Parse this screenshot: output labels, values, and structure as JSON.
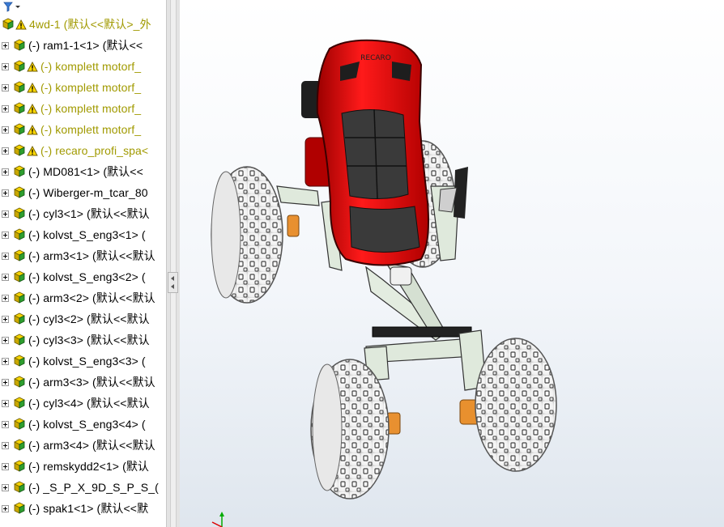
{
  "feature_tree": {
    "filter_icon": "funnel-icon",
    "root": {
      "label": "4wd-1 (默认<<默认>_外",
      "status": "warning"
    },
    "items": [
      {
        "label": "(-) ram1-1<1> (默认<<",
        "status": "normal"
      },
      {
        "label": "(-) komplett motorf_",
        "status": "warning"
      },
      {
        "label": "(-) komplett motorf_",
        "status": "warning"
      },
      {
        "label": "(-) komplett motorf_",
        "status": "warning"
      },
      {
        "label": "(-) komplett motorf_",
        "status": "warning"
      },
      {
        "label": "(-) recaro_profi_spa<",
        "status": "warning"
      },
      {
        "label": "(-) MD081<1> (默认<<",
        "status": "normal"
      },
      {
        "label": "(-) Wiberger-m_tcar_80",
        "status": "normal"
      },
      {
        "label": "(-) cyl3<1> (默认<<默认",
        "status": "normal"
      },
      {
        "label": "(-) kolvst_S_eng3<1> (",
        "status": "normal"
      },
      {
        "label": "(-) arm3<1> (默认<<默认",
        "status": "normal"
      },
      {
        "label": "(-) kolvst_S_eng3<2> (",
        "status": "normal"
      },
      {
        "label": "(-) arm3<2> (默认<<默认",
        "status": "normal"
      },
      {
        "label": "(-) cyl3<2> (默认<<默认",
        "status": "normal"
      },
      {
        "label": "(-) cyl3<3> (默认<<默认",
        "status": "normal"
      },
      {
        "label": "(-) kolvst_S_eng3<3> (",
        "status": "normal"
      },
      {
        "label": "(-) arm3<3> (默认<<默认",
        "status": "normal"
      },
      {
        "label": "(-) cyl3<4> (默认<<默认",
        "status": "normal"
      },
      {
        "label": "(-) kolvst_S_eng3<4> (",
        "status": "normal"
      },
      {
        "label": "(-) arm3<4> (默认<<默认",
        "status": "normal"
      },
      {
        "label": "(-) remskydd2<1> (默认",
        "status": "normal"
      },
      {
        "label": "(-) _S_P_X_9D_S_P_S_(",
        "status": "normal"
      },
      {
        "label": "(-) spak1<1> (默认<<默",
        "status": "normal"
      }
    ]
  },
  "splitter": {
    "grip_icon": "collapse-arrows-icon"
  },
  "graphics": {
    "model_name": "4wd vehicle with racing seat",
    "seat_brand_text": "RECARO",
    "colors": {
      "seat": "#e60000",
      "seat_cushion": "#3a3a3a",
      "tire": "#ffffff",
      "frame": "#dfe9dc",
      "hub": "#e89030",
      "background_bottom": "#dfe6ee"
    },
    "triad_icon": "coordinate-triad-icon"
  }
}
